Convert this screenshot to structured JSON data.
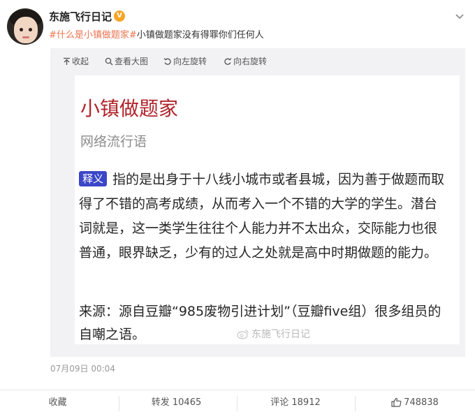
{
  "author": {
    "name": "东施飞行日记",
    "verified_mark": "V"
  },
  "post": {
    "hashtag": "#什么是小镇做题家#",
    "text": "小镇做题家没有得罪你们任何人",
    "timestamp": "07月09日 00:04"
  },
  "media_toolbar": {
    "collapse": "收起",
    "view_large": "查看大图",
    "rotate_left": "向左旋转",
    "rotate_right": "向右旋转"
  },
  "image": {
    "title": "小镇做题家",
    "subtitle": "网络流行语",
    "definition_tag": "释义",
    "definition": "指的是出身于十八线小城市或者县城，因为善于做题而取得了不错的高考成绩，从而考入一个不错的大学的学生。潜台词就是，这一类学生往往个人能力并不太出众，交际能力也很普通，眼界缺乏，少有的过人之处就是高中时期做题的能力。",
    "source": "来源：源自豆瓣“985废物引进计划”（豆瓣five组）很多组员的自嘲之语。",
    "watermark": "东施飞行日记"
  },
  "footer": {
    "favorite": "收藏",
    "repost": "转发 10465",
    "comment": "评论 18912",
    "like": "748838"
  },
  "colors": {
    "hashtag": "#eb7350",
    "title_red": "#b0232a",
    "tag_blue": "#3b46c8",
    "verified_orange": "#f7a525"
  }
}
